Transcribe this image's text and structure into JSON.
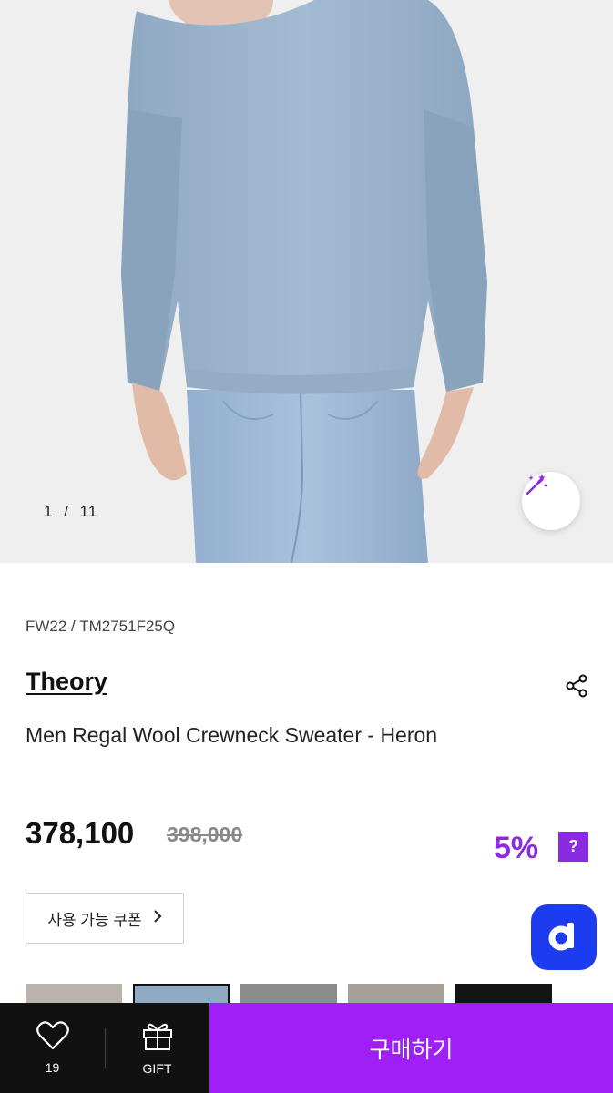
{
  "gallery": {
    "counter_current": "1",
    "counter_separator": "/",
    "counter_total": "11"
  },
  "product": {
    "season_code": "FW22 / TM2751F25Q",
    "brand": "Theory",
    "title": "Men Regal Wool Crewneck Sweater - Heron",
    "price": "378,100",
    "original_price": "398,000",
    "discount": "5%",
    "help_label": "?"
  },
  "coupon": {
    "label": "사용 가능 쿠폰",
    "chevron": "›"
  },
  "colors": {
    "accent": "#9f1ff5",
    "discount": "#8a2be2",
    "app_badge": "#1d3cf0",
    "bar_dark": "#111111"
  },
  "color_options": [
    {
      "name": "grey-beige",
      "color": "#b9b3ab"
    },
    {
      "name": "heron-blue",
      "color": "#90aac4",
      "selected": true
    },
    {
      "name": "charcoal-grey",
      "color": "#8c8c8c"
    },
    {
      "name": "taupe",
      "color": "#a89f98"
    },
    {
      "name": "black",
      "color": "#141414"
    }
  ],
  "bottom_bar": {
    "like_icon": "heart-icon",
    "like_count": "19",
    "gift_icon": "gift-icon",
    "gift_label": "GIFT",
    "buy_label": "구매하기"
  }
}
